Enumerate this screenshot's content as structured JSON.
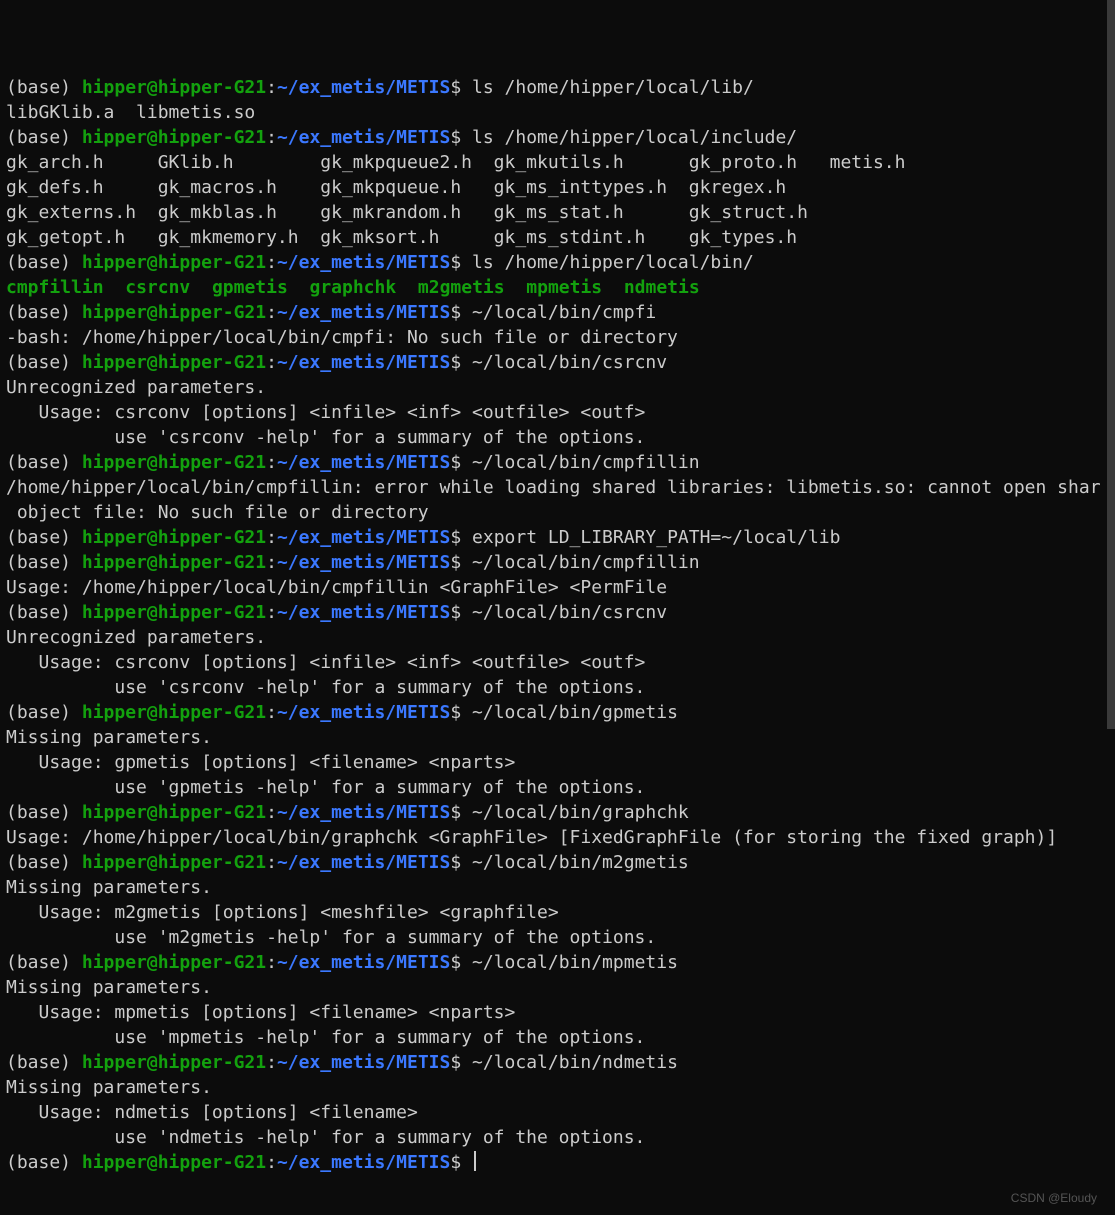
{
  "prompt": {
    "env": "(base) ",
    "user": "hipper@hipper-G21",
    "sep": ":",
    "cwd": "~/ex_metis/METIS",
    "dollar": "$ "
  },
  "lines": [
    {
      "t": "prompt",
      "cmd": "ls /home/hipper/local/lib/"
    },
    {
      "t": "out",
      "text": "libGKlib.a  libmetis.so"
    },
    {
      "t": "prompt",
      "cmd": "ls /home/hipper/local/include/"
    },
    {
      "t": "out",
      "text": "gk_arch.h     GKlib.h        gk_mkpqueue2.h  gk_mkutils.h      gk_proto.h   metis.h"
    },
    {
      "t": "out",
      "text": "gk_defs.h     gk_macros.h    gk_mkpqueue.h   gk_ms_inttypes.h  gkregex.h"
    },
    {
      "t": "out",
      "text": "gk_externs.h  gk_mkblas.h    gk_mkrandom.h   gk_ms_stat.h      gk_struct.h"
    },
    {
      "t": "out",
      "text": "gk_getopt.h   gk_mkmemory.h  gk_mksort.h     gk_ms_stdint.h    gk_types.h"
    },
    {
      "t": "prompt",
      "cmd": "ls /home/hipper/local/bin/"
    },
    {
      "t": "exe",
      "items": [
        "cmpfillin",
        "csrcnv",
        "gpmetis",
        "graphchk",
        "m2gmetis",
        "mpmetis",
        "ndmetis"
      ]
    },
    {
      "t": "prompt",
      "cmd": "~/local/bin/cmpfi"
    },
    {
      "t": "out",
      "text": "-bash: /home/hipper/local/bin/cmpfi: No such file or directory"
    },
    {
      "t": "prompt",
      "cmd": "~/local/bin/csrcnv"
    },
    {
      "t": "out",
      "text": "Unrecognized parameters."
    },
    {
      "t": "out",
      "text": "   Usage: csrconv [options] <infile> <inf> <outfile> <outf>"
    },
    {
      "t": "out",
      "text": "          use 'csrconv -help' for a summary of the options."
    },
    {
      "t": "prompt",
      "cmd": "~/local/bin/cmpfillin"
    },
    {
      "t": "out",
      "text": "/home/hipper/local/bin/cmpfillin: error while loading shared libraries: libmetis.so: cannot open shared object file: No such file or directory"
    },
    {
      "t": "prompt",
      "cmd": "export LD_LIBRARY_PATH=~/local/lib"
    },
    {
      "t": "prompt",
      "cmd": "~/local/bin/cmpfillin"
    },
    {
      "t": "out",
      "text": "Usage: /home/hipper/local/bin/cmpfillin <GraphFile> <PermFile"
    },
    {
      "t": "prompt",
      "cmd": "~/local/bin/csrcnv"
    },
    {
      "t": "out",
      "text": "Unrecognized parameters."
    },
    {
      "t": "out",
      "text": "   Usage: csrconv [options] <infile> <inf> <outfile> <outf>"
    },
    {
      "t": "out",
      "text": "          use 'csrconv -help' for a summary of the options."
    },
    {
      "t": "prompt",
      "cmd": "~/local/bin/gpmetis"
    },
    {
      "t": "out",
      "text": "Missing parameters."
    },
    {
      "t": "out",
      "text": "   Usage: gpmetis [options] <filename> <nparts>"
    },
    {
      "t": "out",
      "text": "          use 'gpmetis -help' for a summary of the options."
    },
    {
      "t": "prompt",
      "cmd": "~/local/bin/graphchk"
    },
    {
      "t": "out",
      "text": "Usage: /home/hipper/local/bin/graphchk <GraphFile> [FixedGraphFile (for storing the fixed graph)]"
    },
    {
      "t": "prompt",
      "cmd": "~/local/bin/m2gmetis"
    },
    {
      "t": "out",
      "text": "Missing parameters."
    },
    {
      "t": "out",
      "text": "   Usage: m2gmetis [options] <meshfile> <graphfile>"
    },
    {
      "t": "out",
      "text": "          use 'm2gmetis -help' for a summary of the options."
    },
    {
      "t": "prompt",
      "cmd": "~/local/bin/mpmetis"
    },
    {
      "t": "out",
      "text": "Missing parameters."
    },
    {
      "t": "out",
      "text": "   Usage: mpmetis [options] <filename> <nparts>"
    },
    {
      "t": "out",
      "text": "          use 'mpmetis -help' for a summary of the options."
    },
    {
      "t": "prompt",
      "cmd": "~/local/bin/ndmetis"
    },
    {
      "t": "out",
      "text": "Missing parameters."
    },
    {
      "t": "out",
      "text": "   Usage: ndmetis [options] <filename>"
    },
    {
      "t": "out",
      "text": "          use 'ndmetis -help' for a summary of the options."
    },
    {
      "t": "prompt",
      "cmd": "",
      "cursor": true
    }
  ],
  "exe_sep": "  ",
  "watermark": "CSDN @Eloudy",
  "wrap_width": 103
}
